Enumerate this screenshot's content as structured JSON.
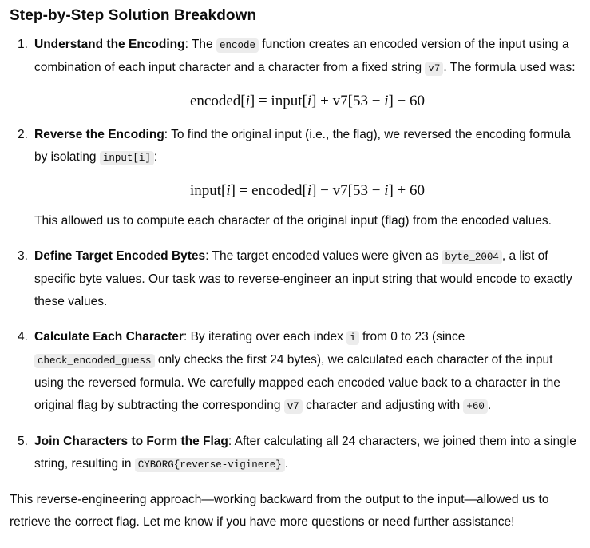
{
  "title": "Step-by-Step Solution Breakdown",
  "steps": [
    {
      "num": "1.",
      "heading": "Understand the Encoding",
      "t1": ": The ",
      "c1": "encode",
      "t2": " function creates an encoded version of the input using a combination of each input character and a character from a fixed string ",
      "c2": "v7",
      "t3": ". The formula used was:",
      "formula": {
        "lhs": "encoded",
        "idx": "i",
        "mid": "] = input[",
        "rest": "] + v7[53 − ",
        "end": "] − 60"
      }
    },
    {
      "num": "2.",
      "heading": "Reverse the Encoding",
      "t1": ": To find the original input (i.e., the flag), we reversed the encoding formula by isolating ",
      "c1": "input[i]",
      "t2": ":",
      "formula": {
        "lhs": "input",
        "idx": "i",
        "mid": "] = encoded[",
        "rest": "] − v7[53 − ",
        "end": "] + 60"
      },
      "note": "This allowed us to compute each character of the original input (flag) from the encoded values."
    },
    {
      "num": "3.",
      "heading": "Define Target Encoded Bytes",
      "t1": ": The target encoded values were given as ",
      "c1": "byte_2004",
      "t2": ", a list of specific byte values. Our task was to reverse-engineer an input string that would encode to exactly these values."
    },
    {
      "num": "4.",
      "heading": "Calculate Each Character",
      "t1": ": By iterating over each index ",
      "c1": "i",
      "t2": " from 0 to 23 (since ",
      "c2": "check_encoded_guess",
      "t3": " only checks the first 24 bytes), we calculated each character of the input using the reversed formula. We carefully mapped each encoded value back to a character in the original flag by subtracting the corresponding ",
      "c3": "v7",
      "t4": " character and adjusting with ",
      "c4": "+60",
      "t5": "."
    },
    {
      "num": "5.",
      "heading": "Join Characters to Form the Flag",
      "t1": ": After calculating all 24 characters, we joined them into a single string, resulting in ",
      "c1": "CYBORG{reverse-viginere}",
      "t2": "."
    }
  ],
  "closing": "This reverse-engineering approach—working backward from the output to the input—allowed us to retrieve the correct flag. Let me know if you have more questions or need further assistance!"
}
